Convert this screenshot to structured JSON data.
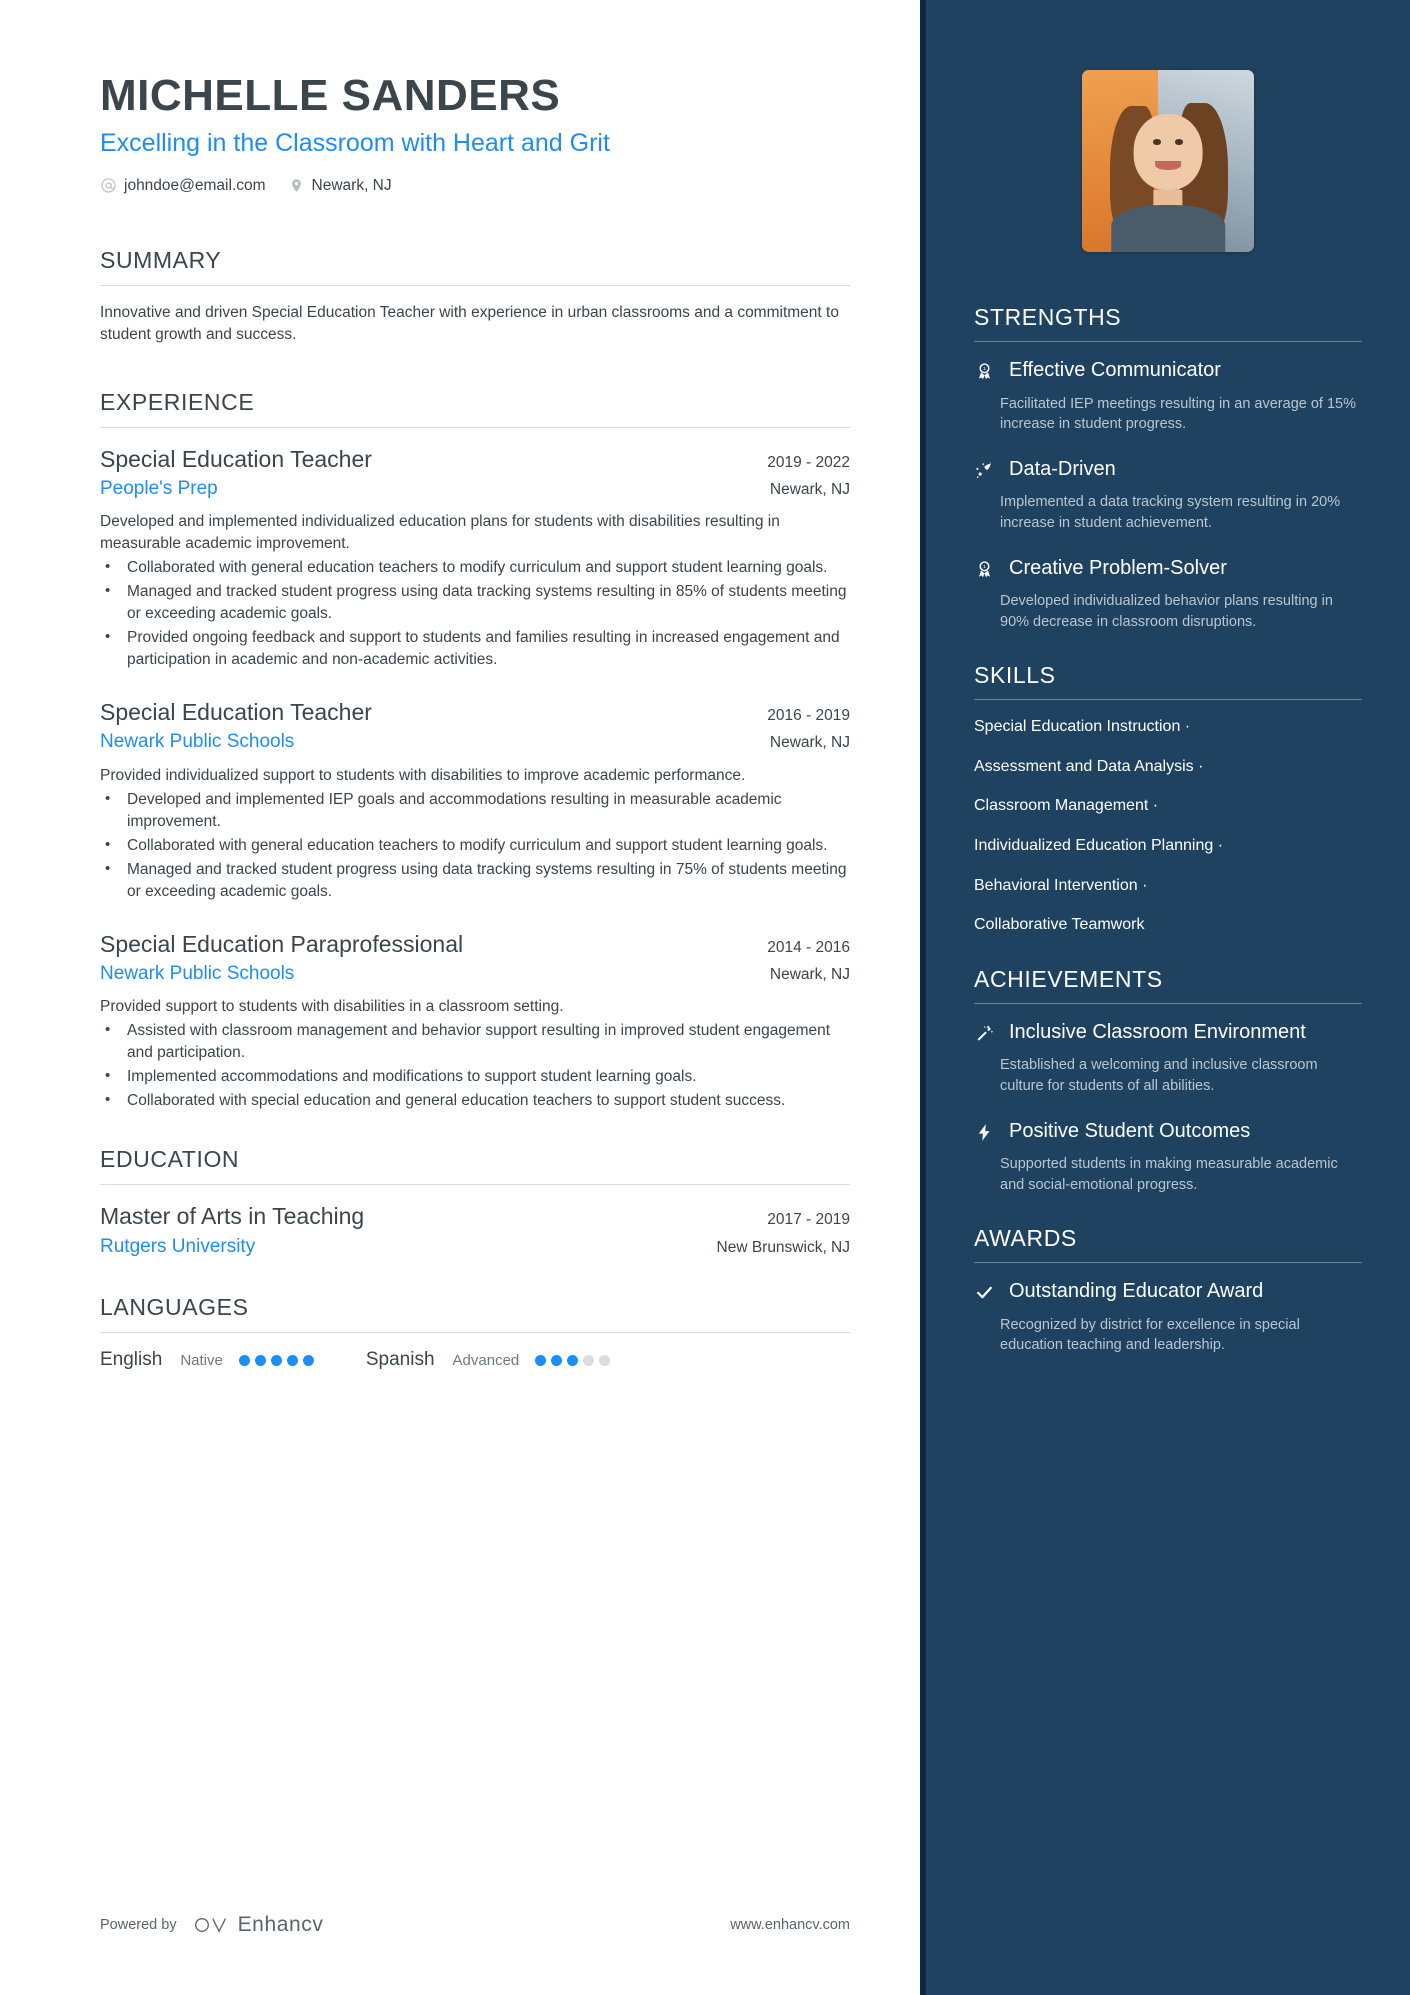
{
  "header": {
    "name": "MICHELLE SANDERS",
    "headline": "Excelling in the Classroom with Heart and Grit",
    "email": "johndoe@email.com",
    "location": "Newark, NJ"
  },
  "summary": {
    "heading": "SUMMARY",
    "text": "Innovative and driven Special Education Teacher with experience in urban classrooms and a commitment to student growth and success."
  },
  "experience": {
    "heading": "EXPERIENCE",
    "entries": [
      {
        "title": "Special Education Teacher",
        "date": "2019 - 2022",
        "org": "People's Prep",
        "location": "Newark, NJ",
        "desc": "Developed and implemented individualized education plans for students with disabilities resulting in measurable academic improvement.",
        "bullets": [
          "Collaborated with general education teachers to modify curriculum and support student learning goals.",
          "Managed and tracked student progress using data tracking systems resulting in 85% of students meeting or exceeding academic goals.",
          "Provided ongoing feedback and support to students and families resulting in increased engagement and participation in academic and non-academic activities."
        ]
      },
      {
        "title": "Special Education Teacher",
        "date": "2016 - 2019",
        "org": "Newark Public Schools",
        "location": "Newark, NJ",
        "desc": "Provided individualized support to students with disabilities to improve academic performance.",
        "bullets": [
          "Developed and implemented IEP goals and accommodations resulting in measurable academic improvement.",
          "Collaborated with general education teachers to modify curriculum and support student learning goals.",
          "Managed and tracked student progress using data tracking systems resulting in 75% of students meeting or exceeding academic goals."
        ]
      },
      {
        "title": "Special Education Paraprofessional",
        "date": "2014 - 2016",
        "org": "Newark Public Schools",
        "location": "Newark, NJ",
        "desc": "Provided support to students with disabilities in a classroom setting.",
        "bullets": [
          "Assisted with classroom management and behavior support resulting in improved student engagement and participation.",
          "Implemented accommodations and modifications to support student learning goals.",
          "Collaborated with special education and general education teachers to support student success."
        ]
      }
    ]
  },
  "education": {
    "heading": "EDUCATION",
    "entries": [
      {
        "title": "Master of Arts in Teaching",
        "date": "2017 - 2019",
        "org": "Rutgers University",
        "location": "New Brunswick, NJ"
      }
    ]
  },
  "languages": {
    "heading": "LANGUAGES",
    "items": [
      {
        "name": "English",
        "level": "Native",
        "filled": 5,
        "total": 5
      },
      {
        "name": "Spanish",
        "level": "Advanced",
        "filled": 3,
        "total": 5
      }
    ]
  },
  "footer": {
    "powered_by": "Powered by",
    "brand": "Enhancv",
    "website": "www.enhancv.com"
  },
  "strengths": {
    "heading": "STRENGTHS",
    "items": [
      {
        "icon": "award-ribbon-icon",
        "title": "Effective Communicator",
        "desc": "Facilitated IEP meetings resulting in an average of 15% increase in student progress."
      },
      {
        "icon": "rocket-trajectory-icon",
        "title": "Data-Driven",
        "desc": "Implemented a data tracking system resulting in 20% increase in student achievement."
      },
      {
        "icon": "award-ribbon-icon",
        "title": "Creative Problem-Solver",
        "desc": "Developed individualized behavior plans resulting in 90% decrease in classroom disruptions."
      }
    ]
  },
  "skills": {
    "heading": "SKILLS",
    "items": [
      "Special Education Instruction",
      "Assessment and Data Analysis",
      "Classroom Management",
      "Individualized Education Planning",
      "Behavioral Intervention",
      "Collaborative Teamwork"
    ],
    "separator": "·"
  },
  "achievements": {
    "heading": "ACHIEVEMENTS",
    "items": [
      {
        "icon": "magic-wand-icon",
        "title": "Inclusive Classroom Environment",
        "desc": "Established a welcoming and inclusive classroom culture for students of all abilities."
      },
      {
        "icon": "lightning-bolt-icon",
        "title": "Positive Student Outcomes",
        "desc": "Supported students in making measurable academic and social-emotional progress."
      }
    ]
  },
  "awards": {
    "heading": "AWARDS",
    "items": [
      {
        "icon": "check-icon",
        "title": "Outstanding Educator Award",
        "desc": "Recognized by district for excellence in special education teaching and leadership."
      }
    ]
  },
  "colors": {
    "accent": "#1d8df5",
    "sidebar": "#1f4260",
    "sidebar_edge": "#10283d",
    "text": "#3a454c"
  }
}
